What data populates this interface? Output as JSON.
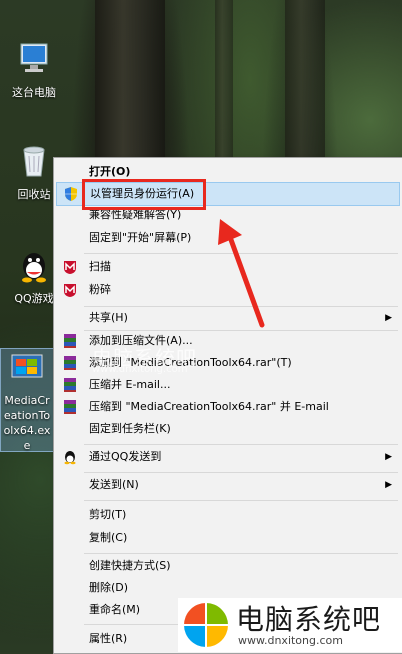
{
  "desktop": {
    "icons": [
      {
        "label": "这台电脑",
        "icon": "computer-icon"
      },
      {
        "label": "回收站",
        "icon": "recycle-bin-icon"
      },
      {
        "label": "QQ游戏",
        "icon": "qq-icon"
      },
      {
        "label": "MediaCreationToolx64.exe",
        "icon": "installer-icon"
      }
    ]
  },
  "context_menu": {
    "items": [
      {
        "label": "打开(O)",
        "bold": true
      },
      {
        "label": "以管理员身份运行(A)",
        "icon": "shield-icon",
        "highlighted": true
      },
      {
        "label": "兼容性疑难解答(Y)"
      },
      {
        "label": "固定到\"开始\"屏幕(P)"
      },
      {
        "label": "扫描",
        "icon": "mcafee-icon"
      },
      {
        "label": "粉碎",
        "icon": "mcafee-icon"
      },
      {
        "label": "共享(H)",
        "submenu": true
      },
      {
        "label": "添加到压缩文件(A)...",
        "icon": "winrar-icon"
      },
      {
        "label": "添加到 \"MediaCreationToolx64.rar\"(T)",
        "icon": "winrar-icon"
      },
      {
        "label": "压缩并 E-mail...",
        "icon": "winrar-icon"
      },
      {
        "label": "压缩到 \"MediaCreationToolx64.rar\" 并 E-mail",
        "icon": "winrar-icon"
      },
      {
        "label": "固定到任务栏(K)"
      },
      {
        "label": "通过QQ发送到",
        "icon": "qq-penguin-icon",
        "submenu": true
      },
      {
        "label": "发送到(N)",
        "submenu": true
      },
      {
        "label": "剪切(T)"
      },
      {
        "label": "复制(C)"
      },
      {
        "label": "创建快捷方式(S)"
      },
      {
        "label": "删除(D)"
      },
      {
        "label": "重命名(M)"
      },
      {
        "label": "属性(R)"
      }
    ],
    "submenu_arrow": "▶"
  },
  "watermark": {
    "overlay_title": "电脑系统吧",
    "overlay_url": "www.dnxitong.com",
    "brand_title": "电脑系统吧",
    "brand_url": "www.dnxitong.com",
    "logo_colors": [
      "#f25022",
      "#7fba00",
      "#00a4ef",
      "#ffb900"
    ]
  },
  "colors": {
    "highlight_bg": "#cce4f7",
    "annotation_red": "#e8281e"
  }
}
